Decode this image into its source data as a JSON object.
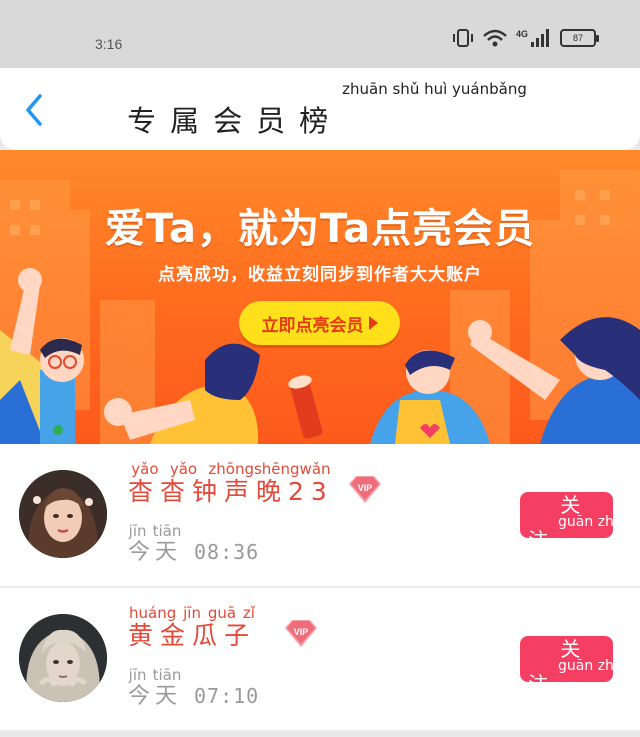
{
  "status_bar": {
    "time": "3:16",
    "network": "4G",
    "battery": "87"
  },
  "header": {
    "back_icon": "chevron-left-icon",
    "title": "专属会员榜",
    "title_pinyin": "zhuān shǔ  huì yuánbǎng"
  },
  "banner": {
    "headline": "爱Ta，就为Ta点亮会员",
    "subtitle": "点亮成功，收益立刻同步到作者大大账户",
    "cta_label": "立即点亮会员"
  },
  "members": [
    {
      "name": "杳杳钟声晚23",
      "name_pinyin": "yǎo yǎo zhōngshēngwǎn",
      "time_label": "今天",
      "time_label_pinyin": "jīn tiān",
      "time": "08:36",
      "vip_badge": "VIP",
      "follow_label": "关注",
      "follow_pinyin": "guān zhù"
    },
    {
      "name": "黄金瓜子",
      "name_pinyin": "huáng jīn guā  zǐ",
      "time_label": "今天",
      "time_label_pinyin": "jīn tiān",
      "time": "07:10",
      "vip_badge": "VIP",
      "follow_label": "关注",
      "follow_pinyin": "guān zhù"
    }
  ],
  "colors": {
    "accent_red": "#e24a3a",
    "follow_button": "#f43f63",
    "banner_orange": "#ff6a1e",
    "cta_yellow": "#ffe01a"
  }
}
